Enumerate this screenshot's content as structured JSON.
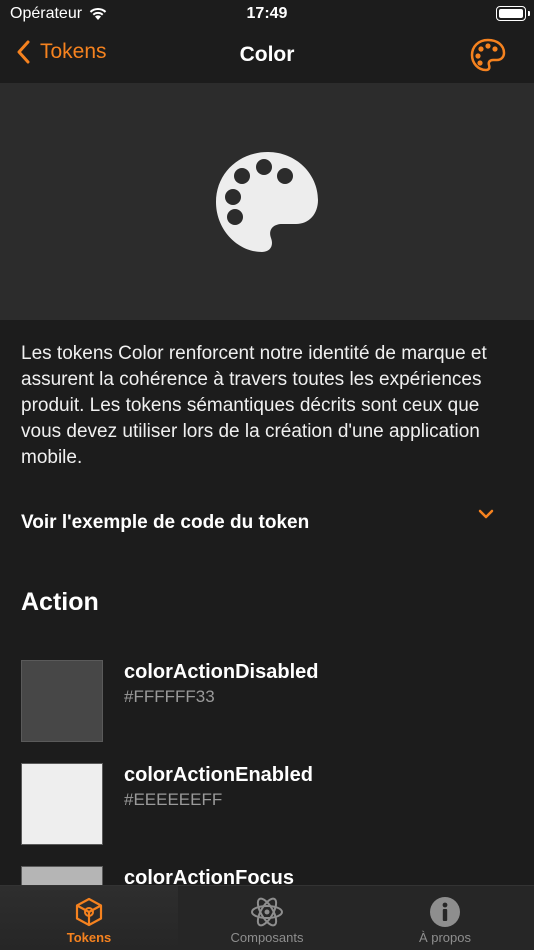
{
  "status_bar": {
    "carrier": "Opérateur",
    "time": "17:49"
  },
  "nav": {
    "back_label": "Tokens",
    "title": "Color"
  },
  "description": "Les tokens Color renforcent notre identité de marque et assurent la cohérence à travers toutes les expériences produit. Les tokens sémantiques décrits sont ceux que vous devez utiliser lors de la création d'une application mobile.",
  "code_toggle_label": "Voir l'exemple de code du token",
  "section_title": "Action",
  "tokens": [
    {
      "name": "colorActionDisabled",
      "hex": "#FFFFFF33",
      "swatch": "#474747"
    },
    {
      "name": "colorActionEnabled",
      "hex": "#EEEEEEFF",
      "swatch": "#eeeeee"
    },
    {
      "name": "colorActionFocus",
      "hex": "",
      "swatch": "#b5b5b5"
    }
  ],
  "tabs": [
    {
      "label": "Tokens",
      "icon": "cube-icon",
      "active": true
    },
    {
      "label": "Composants",
      "icon": "atom-icon",
      "active": false
    },
    {
      "label": "À propos",
      "icon": "info-icon",
      "active": false
    }
  ],
  "colors": {
    "accent": "#f5821f",
    "background": "#1c1c1c",
    "hero": "#2c2c2c"
  }
}
